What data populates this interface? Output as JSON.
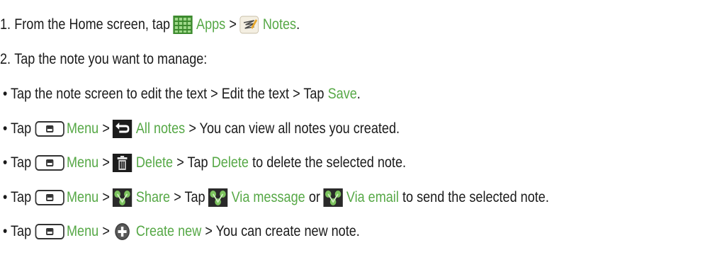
{
  "step1": {
    "number": "1.",
    "text_before": "From the Home screen, tap",
    "apps_icon": "apps-grid-icon",
    "apps_label": "Apps",
    "sep": ">",
    "notes_icon": "notes-app-icon",
    "notes_label": "Notes",
    "end": "."
  },
  "step2": {
    "number": "2.",
    "text": "Tap the note you want to manage:"
  },
  "bullets": {
    "b1": {
      "prefix": "• Tap the note screen to edit the text > Edit the text > Tap",
      "save": "Save",
      "end": "."
    },
    "b2": {
      "tap": "• Tap",
      "menu": "Menu",
      "sep": ">",
      "all_notes": "All notes",
      "rest": "> You can view all notes you created."
    },
    "b3": {
      "tap": "• Tap",
      "menu": "Menu",
      "sep": ">",
      "delete1": "Delete",
      "mid": "> Tap",
      "delete2": "Delete",
      "rest": "to delete the selected note."
    },
    "b4": {
      "tap": "• Tap",
      "menu": "Menu",
      "sep": ">",
      "share": "Share",
      "mid": "> Tap",
      "via_message": "Via message",
      "or": "or",
      "via_email": "Via email",
      "rest": "to send the selected note."
    },
    "b5": {
      "tap": "• Tap",
      "menu": "Menu",
      "sep": ">",
      "create_new": "Create new",
      "rest": "> You can create new note."
    }
  },
  "colors": {
    "accent_green": "#56a846",
    "text": "#1a1a1a"
  }
}
